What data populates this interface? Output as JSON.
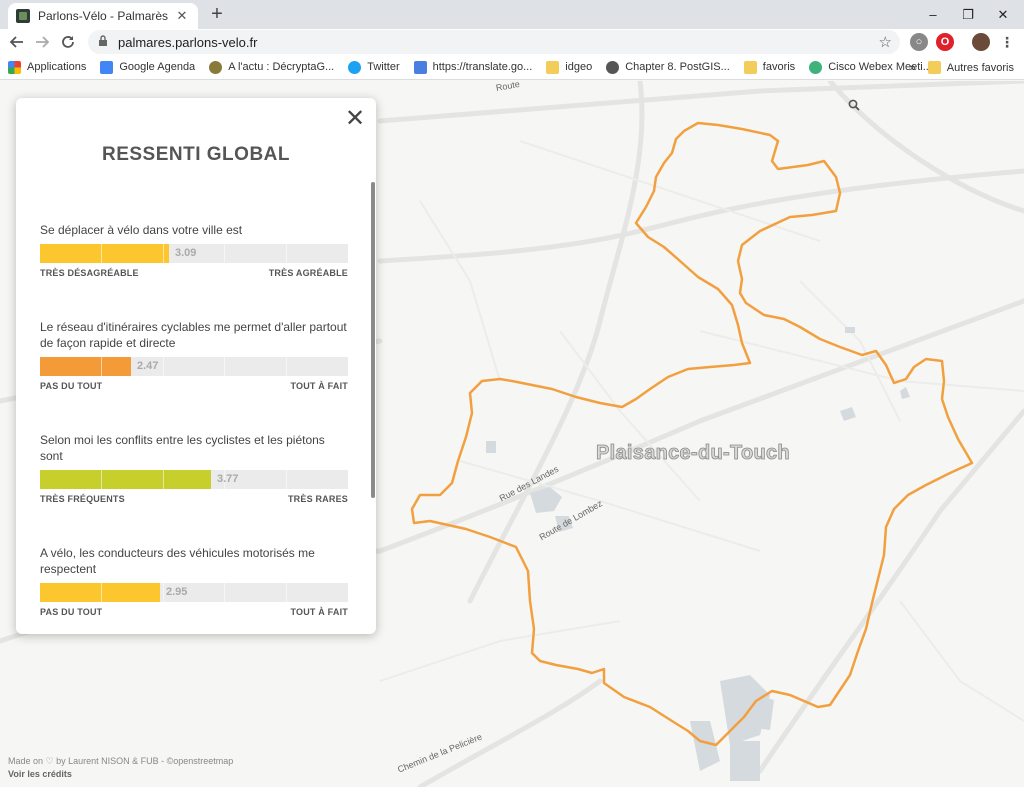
{
  "browser": {
    "tab_title": "Parlons-Vélo - Palmarès",
    "tab_close": "✕",
    "new_tab": "+",
    "url": "palmares.parlons-velo.fr",
    "window_controls": {
      "minimize": "–",
      "maximize": "❐",
      "close": "✕"
    }
  },
  "bookmarks": [
    {
      "label": "Applications",
      "icon": "apps-grid-icon",
      "color": "#ea4335"
    },
    {
      "label": "Google Agenda",
      "icon": "calendar-icon",
      "color": "#4285f4"
    },
    {
      "label": "A l'actu : DécryptaG...",
      "icon": "pin-icon",
      "color": "#8a7a3a"
    },
    {
      "label": "Twitter",
      "icon": "twitter-icon",
      "color": "#1da1f2"
    },
    {
      "label": "https://translate.go...",
      "icon": "translate-icon",
      "color": "#4a7fe0"
    },
    {
      "label": "idgeo",
      "icon": "folder-icon",
      "color": "#f2cd59"
    },
    {
      "label": "Chapter 8. PostGIS...",
      "icon": "globe-icon",
      "color": "#555555"
    },
    {
      "label": "favoris",
      "icon": "folder-icon",
      "color": "#f2cd59"
    },
    {
      "label": "Cisco Webex Meeti...",
      "icon": "webex-icon",
      "color": "#3fb17a"
    }
  ],
  "bookmarks_overflow": "»",
  "bookmarks_other": "Autres favoris",
  "panel": {
    "close": "✕",
    "title": "RESSENTI GLOBAL",
    "questions": [
      {
        "text": "Se déplacer à vélo dans votre ville est",
        "value": 3.09,
        "value_label": "3.09",
        "color": "#fcc72e",
        "min_label": "TRÈS DÉSAGRÉABLE",
        "max_label": "TRÈS AGRÉABLE"
      },
      {
        "text": "Le réseau d'itinéraires cyclables me permet d'aller partout de façon rapide et directe",
        "value": 2.47,
        "value_label": "2.47",
        "color": "#f39a39",
        "min_label": "PAS DU TOUT",
        "max_label": "TOUT À FAIT"
      },
      {
        "text": "Selon moi les conflits entre les cyclistes et les piétons sont",
        "value": 3.77,
        "value_label": "3.77",
        "color": "#c6cf2b",
        "min_label": "TRÈS FRÉQUENTS",
        "max_label": "TRÈS RARES"
      },
      {
        "text": "A vélo, les conducteurs des véhicules motorisés me respectent",
        "value": 2.95,
        "value_label": "2.95",
        "color": "#fcc72e",
        "min_label": "PAS DU TOUT",
        "max_label": "TOUT À FAIT"
      }
    ]
  },
  "map": {
    "city": "Plaisance-du-Touch",
    "roads": {
      "rue_landes": "Rue des Landes",
      "route_lombez": "Route de Lombez",
      "chemin_pelic": "Chemin de la Pelicière",
      "route_top": "Route"
    },
    "outline_color": "#f2a03f",
    "credits_line": "Made on ♡ by Laurent NISON & FUB - ©openstreetmap",
    "credits_link": "Voir les crédits"
  }
}
